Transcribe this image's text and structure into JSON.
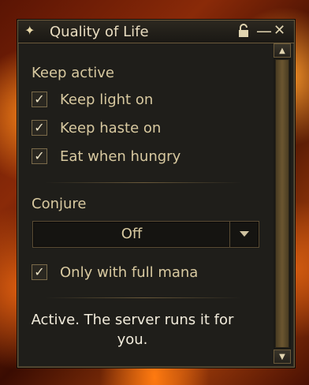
{
  "window": {
    "title": "Quality of Life",
    "icons": {
      "star": "star-icon",
      "lock": "lock-icon",
      "minimize": "minimize-icon",
      "close": "close-icon"
    }
  },
  "keep_active": {
    "label": "Keep active",
    "items": [
      {
        "label": "Keep light on",
        "checked": true
      },
      {
        "label": "Keep haste on",
        "checked": true
      },
      {
        "label": "Eat when hungry",
        "checked": true
      }
    ]
  },
  "conjure": {
    "label": "Conjure",
    "dropdown_value": "Off",
    "full_mana": {
      "label": "Only with full mana",
      "checked": true
    }
  },
  "status_text": "Active. The server runs it for you.",
  "glyphs": {
    "check": "✓",
    "star": "✦",
    "lock": "🔓",
    "minimize": "—",
    "close": "✕",
    "up": "▲",
    "down": "▼"
  }
}
